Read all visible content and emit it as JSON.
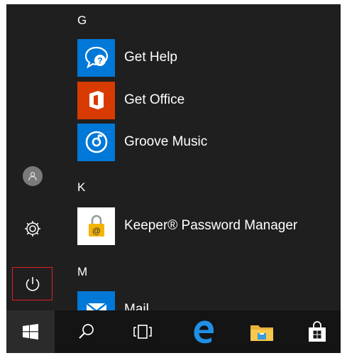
{
  "start_menu": {
    "sections": [
      {
        "letter": "G",
        "apps": [
          {
            "label": "Get Help",
            "icon": "get-help-icon",
            "tile_color": "#0078d7"
          },
          {
            "label": "Get Office",
            "icon": "office-icon",
            "tile_color": "#d83b01"
          },
          {
            "label": "Groove Music",
            "icon": "groove-music-icon",
            "tile_color": "#0078d7"
          }
        ]
      },
      {
        "letter": "K",
        "apps": [
          {
            "label": "Keeper® Password Manager",
            "icon": "keeper-lock-icon",
            "tile_color": "#ffffff"
          }
        ]
      },
      {
        "letter": "M",
        "apps": [
          {
            "label": "Mail",
            "icon": "mail-icon",
            "tile_color": "#0078d7"
          }
        ]
      }
    ],
    "rail": {
      "user_icon": "user-icon",
      "settings_icon": "gear-icon",
      "power_icon": "power-icon",
      "highlight_color": "#e02020"
    }
  },
  "taskbar": {
    "items": [
      "windows-logo-icon",
      "search-icon",
      "task-view-icon",
      "edge-icon",
      "file-explorer-icon",
      "store-icon"
    ]
  }
}
